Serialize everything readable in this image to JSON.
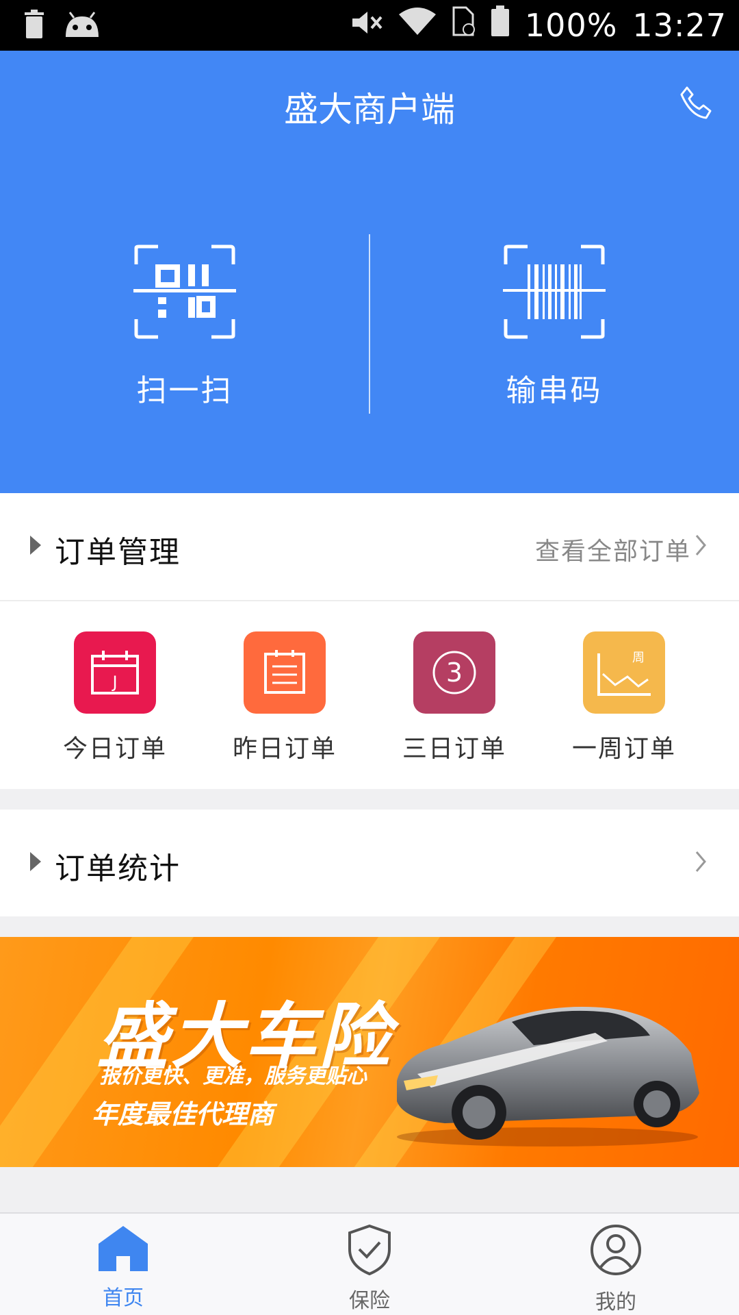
{
  "status_bar": {
    "battery": "100%",
    "time": "13:27"
  },
  "header": {
    "title": "盛大商户端"
  },
  "actions": {
    "scan_label": "扫一扫",
    "serial_label": "输串码"
  },
  "orders": {
    "title": "订单管理",
    "view_all": "查看全部订单",
    "quick": [
      {
        "label": "今日订单",
        "color": "#e8194f",
        "badge": "J"
      },
      {
        "label": "昨日订单",
        "color": "#ff6a3d"
      },
      {
        "label": "三日订单",
        "color": "#b53e62",
        "badge": "3"
      },
      {
        "label": "一周订单",
        "color": "#f5b84c",
        "badge": "周"
      }
    ]
  },
  "stats": {
    "title": "订单统计"
  },
  "banner": {
    "title": "盛大车险",
    "subtitle": "报价更快、更准，服务更贴心",
    "tagline": "年度最佳代理商"
  },
  "nav": {
    "home": "首页",
    "insurance": "保险",
    "mine": "我的",
    "active_color": "#3f86f0"
  }
}
